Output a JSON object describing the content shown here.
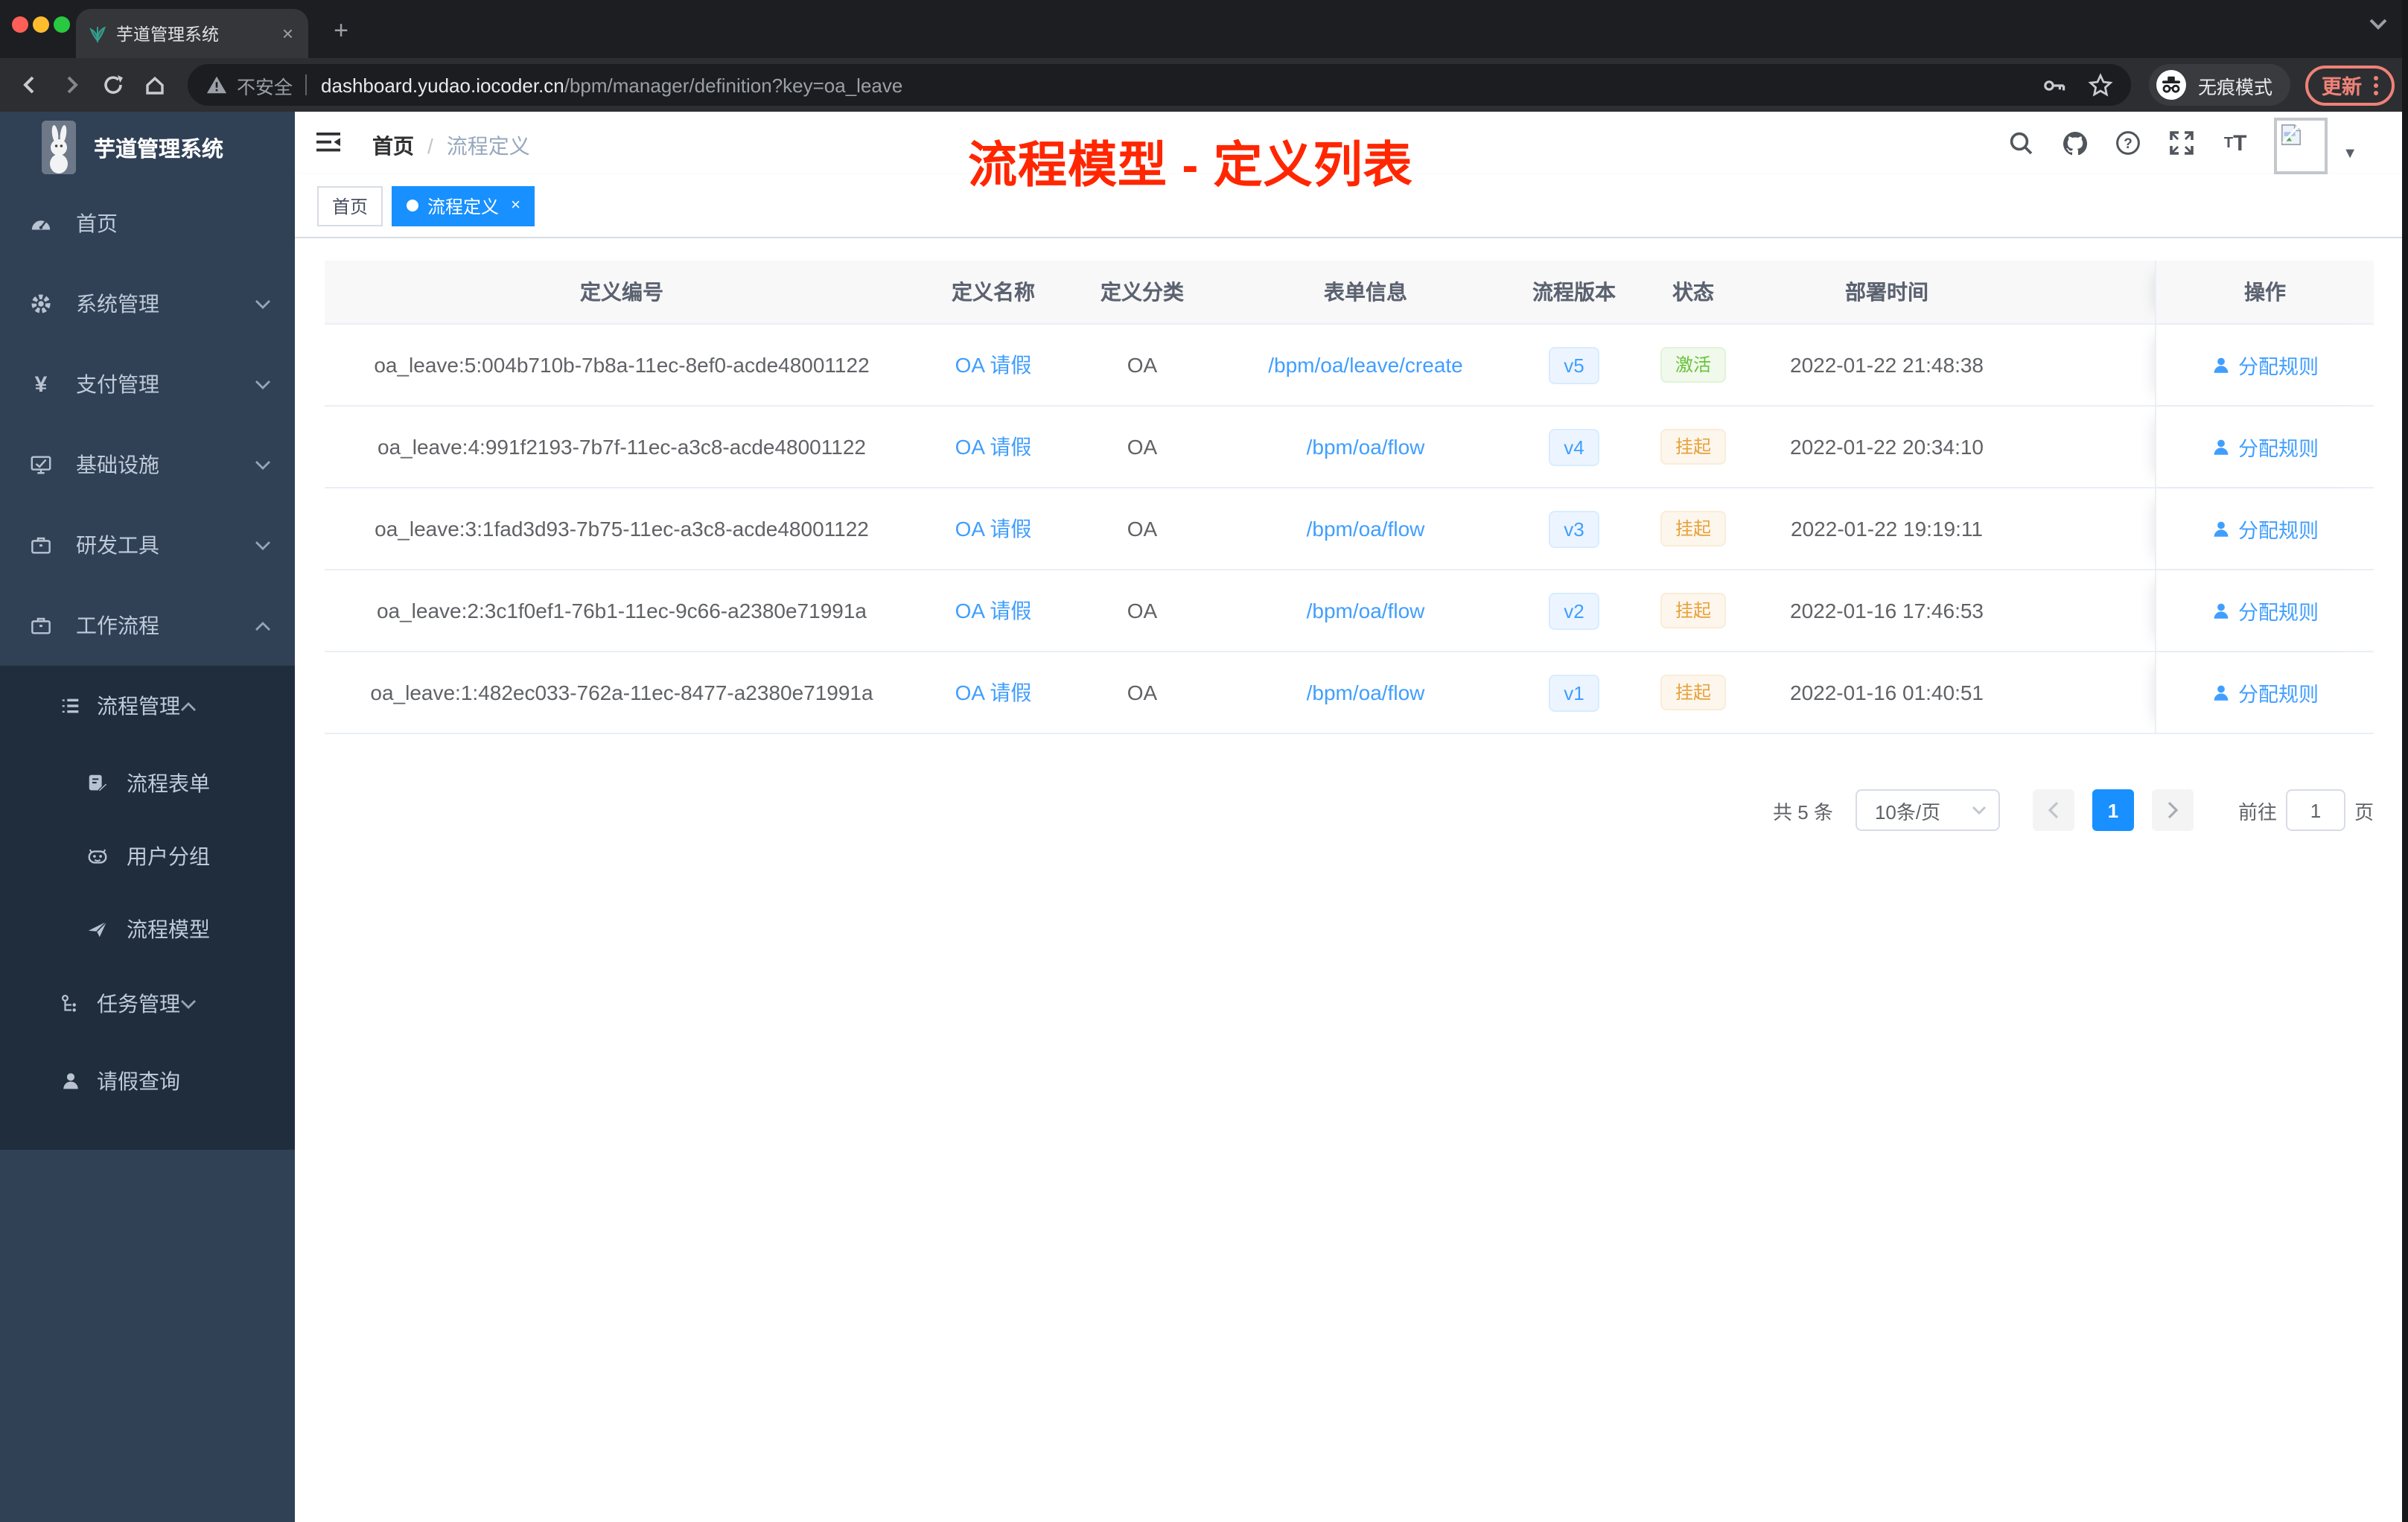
{
  "browser": {
    "tab": {
      "title": "芋道管理系统",
      "close_glyph": "×",
      "new_tab_glyph": "+"
    },
    "address": {
      "security_warning": "不安全",
      "host": "dashboard.yudao.iocoder.cn",
      "path": "/bpm/manager/definition?key=oa_leave"
    },
    "incognito_label": "无痕模式",
    "update_button": "更新"
  },
  "sidebar": {
    "logo_title": "芋道管理系统",
    "items": [
      {
        "label": "首页"
      },
      {
        "label": "系统管理"
      },
      {
        "label": "支付管理"
      },
      {
        "label": "基础设施"
      },
      {
        "label": "研发工具"
      },
      {
        "label": "工作流程"
      }
    ],
    "workflow_submenu": {
      "process_mgmt": "流程管理",
      "process_children": [
        {
          "label": "流程表单"
        },
        {
          "label": "用户分组"
        },
        {
          "label": "流程模型"
        }
      ],
      "task_mgmt": "任务管理",
      "leave_query": "请假查询"
    }
  },
  "header": {
    "breadcrumb_home": "首页",
    "breadcrumb_separator": "/",
    "breadcrumb_current": "流程定义",
    "annotation": "流程模型 - 定义列表"
  },
  "tags": {
    "home": "首页",
    "active": "流程定义",
    "active_close_glyph": "×"
  },
  "table": {
    "columns": [
      "定义编号",
      "定义名称",
      "定义分类",
      "表单信息",
      "流程版本",
      "状态",
      "部署时间",
      "操作"
    ],
    "rows": [
      {
        "id": "oa_leave:5:004b710b-7b8a-11ec-8ef0-acde48001122",
        "name": "OA 请假",
        "category": "OA",
        "form": "/bpm/oa/leave/create",
        "version": "v5",
        "status": "激活",
        "time": "2022-01-22 21:48:38",
        "action": "分配规则"
      },
      {
        "id": "oa_leave:4:991f2193-7b7f-11ec-a3c8-acde48001122",
        "name": "OA 请假",
        "category": "OA",
        "form": "/bpm/oa/flow",
        "version": "v4",
        "status": "挂起",
        "time": "2022-01-22 20:34:10",
        "action": "分配规则"
      },
      {
        "id": "oa_leave:3:1fad3d93-7b75-11ec-a3c8-acde48001122",
        "name": "OA 请假",
        "category": "OA",
        "form": "/bpm/oa/flow",
        "version": "v3",
        "status": "挂起",
        "time": "2022-01-22 19:19:11",
        "action": "分配规则"
      },
      {
        "id": "oa_leave:2:3c1f0ef1-76b1-11ec-9c66-a2380e71991a",
        "name": "OA 请假",
        "category": "OA",
        "form": "/bpm/oa/flow",
        "version": "v2",
        "status": "挂起",
        "time": "2022-01-16 17:46:53",
        "action": "分配规则"
      },
      {
        "id": "oa_leave:1:482ec033-762a-11ec-8477-a2380e71991a",
        "name": "OA 请假",
        "category": "OA",
        "form": "/bpm/oa/flow",
        "version": "v1",
        "status": "挂起",
        "time": "2022-01-16 01:40:51",
        "action": "分配规则"
      }
    ]
  },
  "pagination": {
    "total": "共 5 条",
    "page_size": "10条/页",
    "current_page": "1",
    "goto_label": "前往",
    "goto_value": "1",
    "page_unit": "页"
  },
  "colors": {
    "accent_blue": "#409eff",
    "active_tag_blue": "#1890ff",
    "status_active_green": "#67c23a",
    "status_suspend_orange": "#e6a23c",
    "annotation_red": "#ff2600",
    "sidebar_bg": "#304156",
    "sidebar_submenu_bg": "#1f2d3d"
  }
}
